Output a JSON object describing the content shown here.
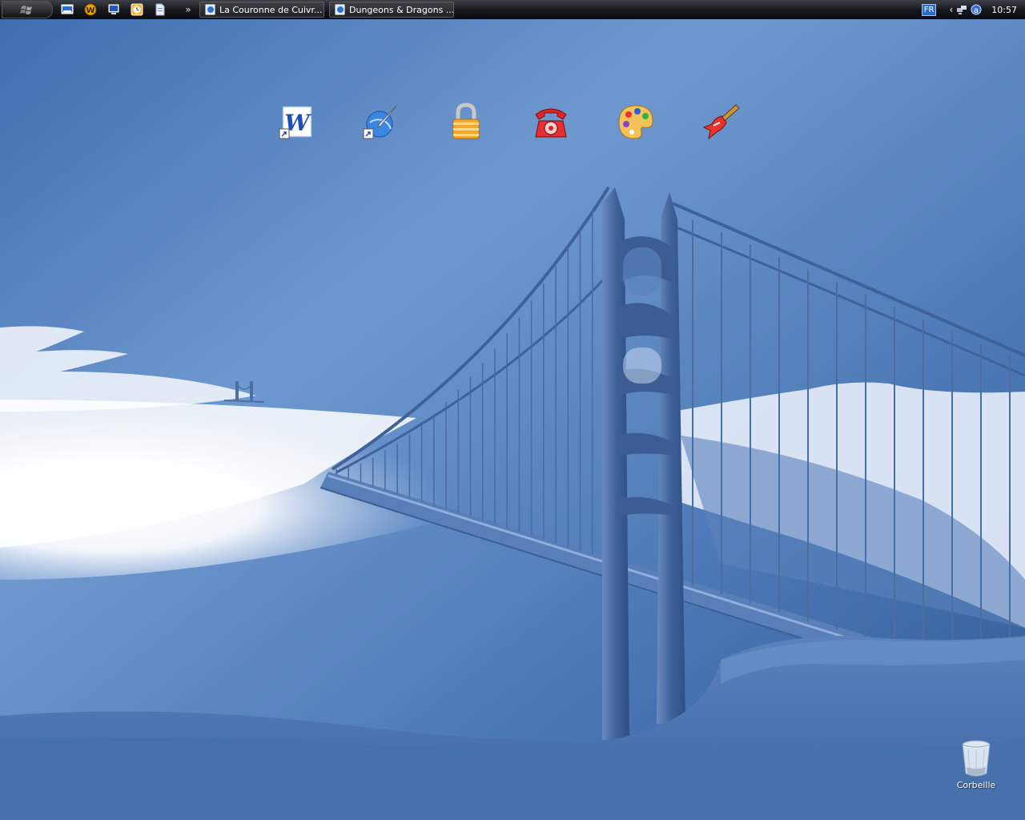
{
  "taskbar": {
    "start_icon": "windows-flag-icon",
    "quick_launch": [
      {
        "name": "show-desktop-icon"
      },
      {
        "name": "winamp-icon"
      },
      {
        "name": "my-computer-icon"
      },
      {
        "name": "clock-app-icon"
      },
      {
        "name": "document-icon"
      }
    ],
    "more_label": "»",
    "tasks": [
      {
        "label": "La Couronne de Cuivr..."
      },
      {
        "label": "Dungeons & Dragons ..."
      }
    ],
    "tray": {
      "language": "FR",
      "expand_label": "‹",
      "time": "10:57"
    }
  },
  "desktop": {
    "icons": [
      {
        "name": "word-shortcut-icon"
      },
      {
        "name": "paint-brush-globe-shortcut-icon"
      },
      {
        "name": "padlock-icon"
      },
      {
        "name": "red-telephone-icon"
      },
      {
        "name": "palette-icon"
      },
      {
        "name": "electric-guitar-icon"
      }
    ],
    "recycle_bin_label": "Corbeille"
  },
  "colors": {
    "sky": "#4a78b6",
    "fog": "#ffffff",
    "bridge": "#4d6fa3"
  }
}
